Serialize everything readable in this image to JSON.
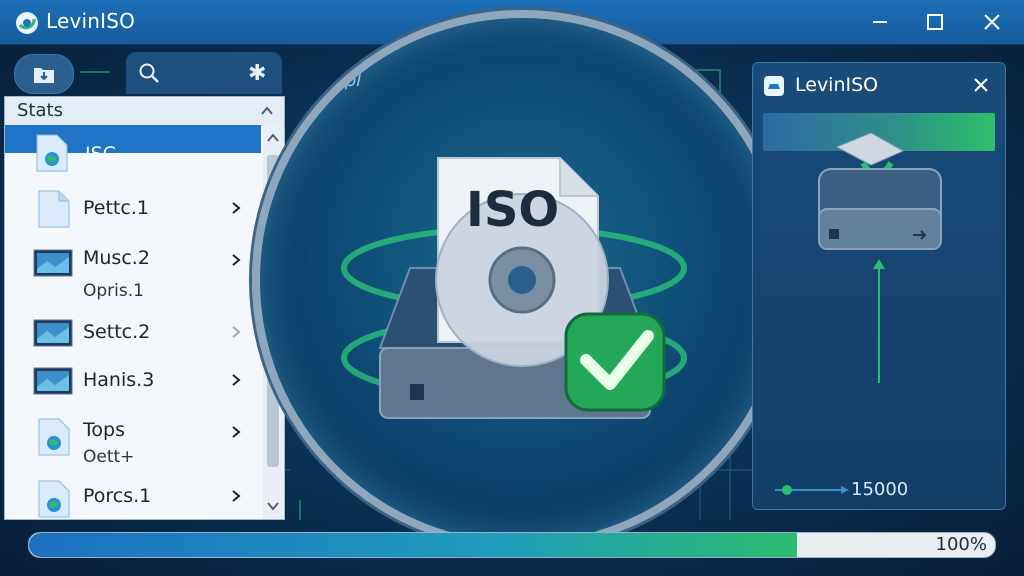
{
  "window": {
    "title": "LevinISO",
    "controls": {
      "minimize_icon": "minimize-icon",
      "maximize_icon": "maximize-icon",
      "close_icon": "close-icon"
    }
  },
  "sidebar": {
    "header": "Stats",
    "items": [
      {
        "label": "ISC",
        "icon": "globe-file-icon",
        "selected": true
      },
      {
        "label": "Pettc.1",
        "icon": "file-icon",
        "selected": false
      },
      {
        "label": "Musc.2",
        "sublabel": "Opris.1",
        "icon": "monitor-icon",
        "selected": false
      },
      {
        "label": "Settc.2",
        "icon": "monitor-icon",
        "selected": false
      },
      {
        "label": "Hanis.3",
        "icon": "monitor-icon",
        "selected": false
      },
      {
        "label": "Tops",
        "sublabel": "Oett+",
        "icon": "globe-file-icon",
        "selected": false
      },
      {
        "label": "Porcs.1",
        "icon": "globe-file-icon",
        "selected": false
      }
    ]
  },
  "main": {
    "faint_text": "Impl",
    "iso_label": "ISO"
  },
  "right_panel": {
    "title": "LevinISO",
    "value": "15000"
  },
  "progress": {
    "label": "100%",
    "fill_fraction": 0.795
  },
  "colors": {
    "accent_blue": "#1f74c8",
    "accent_green": "#2dbb6f",
    "titlebar": "#1d6fb8"
  }
}
